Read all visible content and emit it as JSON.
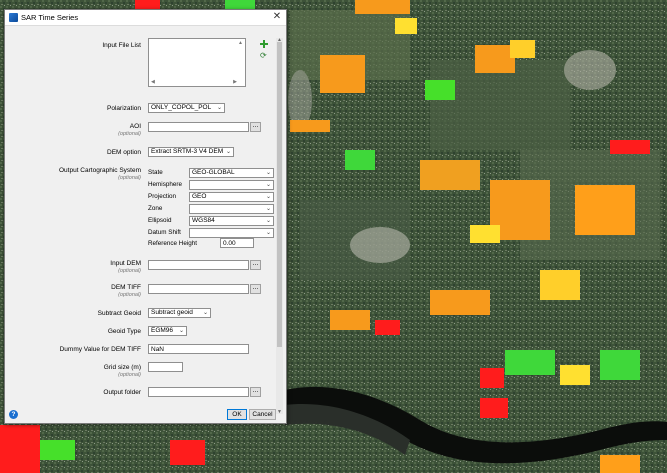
{
  "dialog": {
    "title": "SAR Time Series",
    "close_glyph": "✕",
    "input_file_list": {
      "label": "Input File List"
    },
    "polarization": {
      "label": "Polarization",
      "value": "ONLY_COPOL_POL"
    },
    "aoi": {
      "label": "AOI",
      "sub": "(optional)",
      "value": ""
    },
    "dem_option": {
      "label": "DEM option",
      "value": "Extract SRTM-3 V4 DEM"
    },
    "ocs": {
      "label": "Output Cartographic System",
      "sub": "(optional)",
      "rows": [
        {
          "label": "State",
          "value": "GEO-GLOBAL"
        },
        {
          "label": "Hemisphere",
          "value": ""
        },
        {
          "label": "Projection",
          "value": "GEO"
        },
        {
          "label": "Zone",
          "value": ""
        },
        {
          "label": "Ellipsoid",
          "value": "WGS84"
        },
        {
          "label": "Datum Shift",
          "value": ""
        }
      ],
      "reference_height": {
        "label": "Reference Height",
        "value": "0.00"
      }
    },
    "input_dem": {
      "label": "Input DEM",
      "sub": "(optional)",
      "value": ""
    },
    "dem_tiff": {
      "label": "DEM TIFF",
      "sub": "(optional)",
      "value": ""
    },
    "subtract_geoid": {
      "label": "Subtract Geoid",
      "value": "Subtract geoid"
    },
    "geoid_type": {
      "label": "Geoid Type",
      "value": "EGM96"
    },
    "dummy_value": {
      "label": "Dummy Value for DEM TIFF",
      "value": "NaN"
    },
    "grid_size": {
      "label": "Grid size (m)",
      "sub": "(optional)",
      "value": ""
    },
    "output_folder": {
      "label": "Output folder",
      "value": ""
    },
    "browse_label": "...",
    "ok_label": "OK",
    "cancel_label": "Cancel",
    "help_glyph": "?",
    "icons": {
      "add": "plus-icon",
      "refresh": "refresh-icon",
      "help": "help-icon"
    },
    "colors": {
      "add_icon": "#2e9b2e",
      "help_icon": "#1a6fd0",
      "default_button_border": "#0078d7"
    }
  }
}
